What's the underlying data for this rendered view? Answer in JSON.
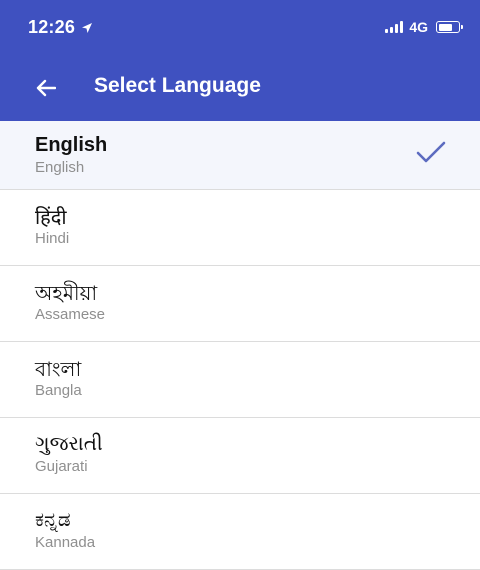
{
  "status_bar": {
    "time": "12:26",
    "network": "4G",
    "icons": [
      "location-arrow-icon",
      "signal-icon",
      "battery-icon"
    ]
  },
  "nav": {
    "title": "Select Language",
    "back_icon": "arrow-left-icon"
  },
  "colors": {
    "primary": "#3f51c0",
    "selected_bg": "#f4f6fc",
    "check": "#5c6bc0",
    "subtext": "#8f8f8f"
  },
  "languages": [
    {
      "native": "English",
      "english": "English",
      "selected": true
    },
    {
      "native": "हिंदी",
      "english": "Hindi",
      "selected": false
    },
    {
      "native": "অহমীয়া",
      "english": "Assamese",
      "selected": false
    },
    {
      "native": "বাংলা",
      "english": "Bangla",
      "selected": false
    },
    {
      "native": "ગુજરાતી",
      "english": "Gujarati",
      "selected": false
    },
    {
      "native": "ಕನ್ನಡ",
      "english": "Kannada",
      "selected": false
    }
  ]
}
